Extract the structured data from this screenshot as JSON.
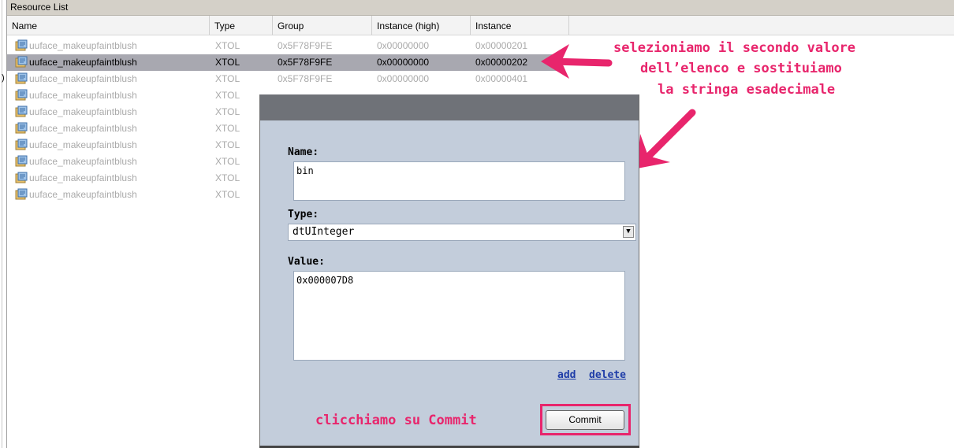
{
  "panel": {
    "title": "Resource List"
  },
  "columns": [
    "Name",
    "Type",
    "Group",
    "Instance (high)",
    "Instance"
  ],
  "rows": [
    {
      "name": "uuface_makeupfaintblush",
      "type": "XTOL",
      "group": "0x5F78F9FE",
      "instance_high": "0x00000000",
      "instance": "0x00000201",
      "selected": false
    },
    {
      "name": "uuface_makeupfaintblush",
      "type": "XTOL",
      "group": "0x5F78F9FE",
      "instance_high": "0x00000000",
      "instance": "0x00000202",
      "selected": true
    },
    {
      "name": "uuface_makeupfaintblush",
      "type": "XTOL",
      "group": "0x5F78F9FE",
      "instance_high": "0x00000000",
      "instance": "0x00000401",
      "selected": false
    },
    {
      "name": "uuface_makeupfaintblush",
      "type": "XTOL",
      "selected": false
    },
    {
      "name": "uuface_makeupfaintblush",
      "type": "XTOL",
      "selected": false
    },
    {
      "name": "uuface_makeupfaintblush",
      "type": "XTOL",
      "selected": false
    },
    {
      "name": "uuface_makeupfaintblush",
      "type": "XTOL",
      "selected": false
    },
    {
      "name": "uuface_makeupfaintblush",
      "type": "XTOL",
      "selected": false
    },
    {
      "name": "uuface_makeupfaintblush",
      "type": "XTOL",
      "selected": false
    },
    {
      "name": "uuface_makeupfaintblush",
      "type": "XTOL",
      "selected": false
    }
  ],
  "row_marker": ")",
  "row_icon": "resource-file-icon",
  "dialog": {
    "name_label": "Name:",
    "name_value": "bin",
    "type_label": "Type:",
    "type_value": "dtUInteger",
    "value_label": "Value:",
    "value_value": "0x000007D8",
    "add_link": "add",
    "delete_link": "delete",
    "commit_button": "Commit"
  },
  "annotations": {
    "top_line1": "selezioniamo il secondo valore",
    "top_line2": "dell’elenco e sostituiamo",
    "top_line3": "la stringa esadecimale",
    "commit_note": "clicchiamo su Commit"
  },
  "colors": {
    "annotation": "#e8256c",
    "dialog_bg": "#c3cddb",
    "selected_row": "#a8a8b0",
    "link": "#1f3da8"
  }
}
